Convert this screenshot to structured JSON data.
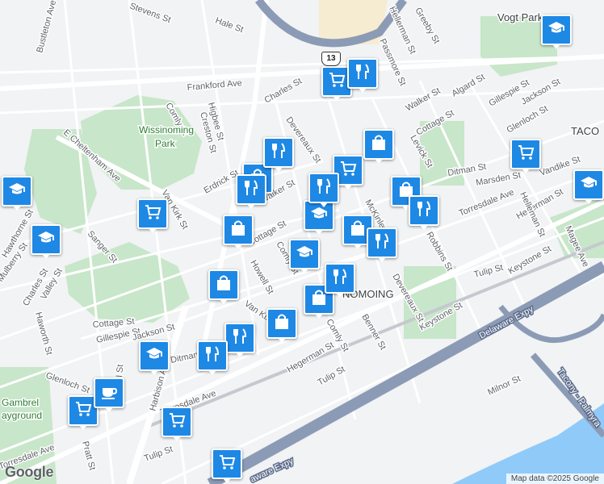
{
  "map": {
    "neighborhoods": {
      "taco": "TACO",
      "nomoing": "NOMOING",
      "wissinoming_park": "Wissinoming\nPark",
      "vogt_park": "Vogt Park",
      "gambrel": "Gambrel\nayground"
    },
    "streets": {
      "bustleton": "Bustleton Ave",
      "stevens": "Stevens St",
      "hale": "Hale St",
      "frankford": "Frankford Ave",
      "higbee": "Higbee St",
      "creston": "Creston St",
      "comly_nw": "Comly St",
      "charles": "Charles St",
      "devereaux": "Devereaux St",
      "e_cheltenham": "E Cheltenham Ave",
      "erdrick": "Erdrick St",
      "van_kirk_n": "Van Kirk St",
      "walker": "Walker St",
      "cottage": "Cottage St",
      "comly_mid": "Comly St",
      "howell": "Howell St",
      "sanger": "Sanger St",
      "mulberry": "Mulberry St",
      "hawthorne": "Hawthorne St",
      "charles_w": "Charles St",
      "valley": "Valley St",
      "haworth": "Haworth St",
      "cottage_sw": "Cottage St",
      "gillespie_sw": "Gillespie St",
      "jackson_sw": "Jackson St",
      "van_kirk_s": "Van Kirk St",
      "glenloch_sw": "Glenloch St",
      "ditman_sw": "Ditman St",
      "harbison": "Harbison Ave",
      "bill": "Bill St",
      "torresdale_sw": "Torresdale Ave",
      "torresdale_w": "Torresdale Ave",
      "pratt": "Pratt St",
      "tulip_sw": "Tulip St",
      "hegerman_s": "Hegerman St",
      "comly_s": "Comly St",
      "tulip_s": "Tulip St",
      "benner": "Benner St",
      "keystone": "Keystone St",
      "devereaux_s": "Devereaux St",
      "robbins": "Robbins St",
      "levick": "Levick St",
      "walker_ne": "Walker St",
      "algard": "Algard St",
      "gillespie_ne": "Gillespie St",
      "jackson_ne": "Jackson St",
      "glenloch_ne": "Glenloch St",
      "cottage_ne": "Cottage St",
      "ditman_ne": "Ditman St",
      "marsden": "Marsden St",
      "vandike": "Vandike St",
      "torresdale_ne": "Torresdale Ave",
      "hegerman_ne": "Hegerman St",
      "helleman": "Helleman St",
      "magee": "Magee Ave",
      "keystone_ne": "Keystone St",
      "tulip_ne": "Tulip St",
      "greeby": "Greeby St",
      "hellerman_n": "Hellerman St",
      "passmore": "Passmore St",
      "mckinley": "McKinley St",
      "delaware_expy": "Delaware Expy",
      "delaware_expy_s": "aware Expy",
      "tacony_palmyra": "Tacony - Palmyra",
      "milnor": "Milnor St",
      "route_13": "13"
    },
    "pins": [
      {
        "type": "graduation-cap",
        "label": "school"
      },
      {
        "type": "shopping-cart",
        "label": "grocery"
      },
      {
        "type": "shopping-bag",
        "label": "shopping"
      },
      {
        "type": "fork-knife",
        "label": "restaurant"
      },
      {
        "type": "coffee-cup",
        "label": "cafe"
      }
    ]
  },
  "footer": {
    "google_logo": "Google",
    "attribution": "Map data ©2025 Google"
  },
  "colors": {
    "pin": "#1e88e5",
    "park": "#c8e6c9",
    "water": "#90caf9",
    "highway": "#8c9bb5",
    "road": "#ffffff"
  }
}
